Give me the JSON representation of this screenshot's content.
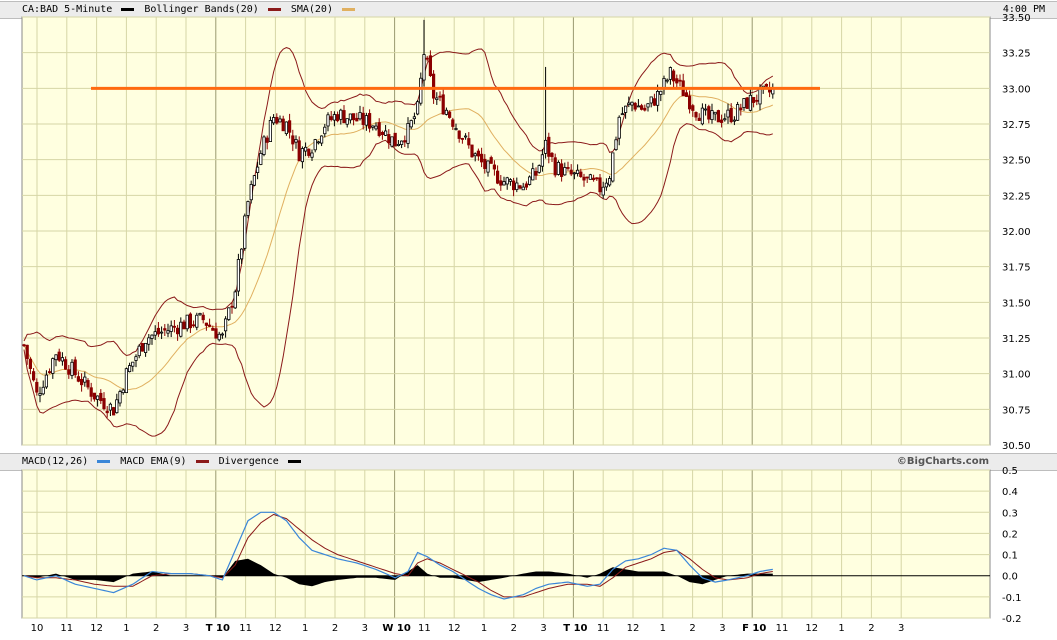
{
  "header": {
    "symbol": "CA:BAD 5-Minute",
    "legend": [
      {
        "label": "Bollinger Bands(20)",
        "color": "#000000"
      },
      {
        "label": "SMA(20)",
        "color": "#8b1a1a"
      },
      {
        "label": "",
        "color": "#e0b060"
      }
    ],
    "time": "4:00 PM"
  },
  "macd_header": {
    "legend": [
      {
        "label": "MACD(12,26)",
        "color": "#3a86d8"
      },
      {
        "label": "MACD EMA(9)",
        "color": "#8b1a1a"
      },
      {
        "label": "Divergence",
        "color": "#000000"
      }
    ],
    "watermark": "©BigCharts.com"
  },
  "colors": {
    "panel_bg": "#ffffe0",
    "grid": "#d6d6a6",
    "bollinger": "#8b1a1a",
    "sma": "#e0b060",
    "resistance": "#ff6a10",
    "candle_up": "#000000",
    "candle_down": "#8b0000",
    "macd": "#3a86d8",
    "macd_ema": "#8b1a1a",
    "divergence": "#000000"
  },
  "x_axis": {
    "labels": [
      "10",
      "11",
      "12",
      "1",
      "2",
      "3",
      "T 10",
      "11",
      "12",
      "1",
      "2",
      "3",
      "W 10",
      "11",
      "12",
      "1",
      "2",
      "3",
      "T 10",
      "11",
      "12",
      "1",
      "2",
      "3",
      "F 10",
      "11",
      "12",
      "1",
      "2",
      "3"
    ],
    "day_markers": [
      "T",
      "W",
      "T",
      "F"
    ]
  },
  "chart_data": [
    {
      "type": "candlestick",
      "title": "CA:BAD 5-Minute",
      "y_ticks": [
        "30.50",
        "30.75",
        "31.00",
        "31.25",
        "31.50",
        "31.75",
        "32.00",
        "32.25",
        "32.50",
        "32.75",
        "33.00",
        "33.25",
        "33.50"
      ],
      "ylim": [
        30.5,
        33.5
      ],
      "grid": true,
      "resistance_level": 33.0,
      "close_path": [
        [
          0,
          31.2
        ],
        [
          4,
          30.85
        ],
        [
          10,
          31.15
        ],
        [
          16,
          31.0
        ],
        [
          22,
          30.85
        ],
        [
          28,
          30.75
        ],
        [
          32,
          31.0
        ],
        [
          38,
          31.25
        ],
        [
          44,
          31.3
        ],
        [
          50,
          31.35
        ],
        [
          56,
          31.38
        ],
        [
          62,
          31.25
        ],
        [
          66,
          31.6
        ],
        [
          70,
          32.2
        ],
        [
          74,
          32.55
        ],
        [
          78,
          32.8
        ],
        [
          82,
          32.75
        ],
        [
          86,
          32.55
        ],
        [
          90,
          32.6
        ],
        [
          94,
          32.75
        ],
        [
          98,
          32.82
        ],
        [
          104,
          32.78
        ],
        [
          110,
          32.75
        ],
        [
          116,
          32.62
        ],
        [
          120,
          32.7
        ],
        [
          123,
          32.85
        ],
        [
          125,
          33.25
        ],
        [
          128,
          32.95
        ],
        [
          132,
          32.85
        ],
        [
          136,
          32.7
        ],
        [
          140,
          32.55
        ],
        [
          144,
          32.45
        ],
        [
          150,
          32.35
        ],
        [
          156,
          32.32
        ],
        [
          160,
          32.4
        ],
        [
          163,
          32.6
        ],
        [
          166,
          32.45
        ],
        [
          170,
          32.4
        ],
        [
          176,
          32.35
        ],
        [
          180,
          32.3
        ],
        [
          183,
          32.4
        ],
        [
          186,
          32.8
        ],
        [
          190,
          32.9
        ],
        [
          194,
          32.85
        ],
        [
          198,
          32.95
        ],
        [
          202,
          33.1
        ],
        [
          206,
          32.98
        ],
        [
          210,
          32.85
        ],
        [
          214,
          32.78
        ],
        [
          218,
          32.8
        ],
        [
          222,
          32.82
        ],
        [
          226,
          32.9
        ],
        [
          230,
          32.95
        ],
        [
          234,
          32.98
        ]
      ],
      "spikes": [
        {
          "bar": 125,
          "high": 33.48
        },
        {
          "bar": 163,
          "high": 33.15
        }
      ],
      "notes": "Bollinger Bands(20) and SMA(20) overlays on 5-minute bars over 4 sessions"
    },
    {
      "type": "line",
      "title": "MACD(12,26)",
      "y_ticks": [
        "0.5",
        "0.4",
        "0.3",
        "0.2",
        "0.1",
        "0.0",
        "-0.1",
        "-0.2"
      ],
      "ylim": [
        -0.2,
        0.5
      ],
      "grid": true,
      "series": [
        {
          "name": "MACD(12,26)",
          "points": [
            [
              0,
              0.0
            ],
            [
              4,
              -0.02
            ],
            [
              10,
              0.0
            ],
            [
              16,
              -0.04
            ],
            [
              22,
              -0.06
            ],
            [
              28,
              -0.08
            ],
            [
              34,
              -0.04
            ],
            [
              40,
              0.02
            ],
            [
              46,
              0.01
            ],
            [
              52,
              0.01
            ],
            [
              58,
              0.0
            ],
            [
              62,
              -0.02
            ],
            [
              66,
              0.12
            ],
            [
              70,
              0.26
            ],
            [
              74,
              0.3
            ],
            [
              78,
              0.3
            ],
            [
              82,
              0.26
            ],
            [
              86,
              0.18
            ],
            [
              90,
              0.12
            ],
            [
              94,
              0.1
            ],
            [
              98,
              0.08
            ],
            [
              104,
              0.06
            ],
            [
              110,
              0.03
            ],
            [
              116,
              -0.01
            ],
            [
              120,
              0.02
            ],
            [
              123,
              0.11
            ],
            [
              126,
              0.09
            ],
            [
              130,
              0.05
            ],
            [
              134,
              0.02
            ],
            [
              138,
              -0.02
            ],
            [
              142,
              -0.06
            ],
            [
              146,
              -0.09
            ],
            [
              150,
              -0.11
            ],
            [
              156,
              -0.09
            ],
            [
              160,
              -0.06
            ],
            [
              164,
              -0.04
            ],
            [
              170,
              -0.03
            ],
            [
              176,
              -0.05
            ],
            [
              180,
              -0.04
            ],
            [
              184,
              0.03
            ],
            [
              188,
              0.07
            ],
            [
              192,
              0.08
            ],
            [
              196,
              0.1
            ],
            [
              200,
              0.13
            ],
            [
              204,
              0.12
            ],
            [
              208,
              0.05
            ],
            [
              212,
              -0.01
            ],
            [
              216,
              -0.03
            ],
            [
              220,
              -0.02
            ],
            [
              226,
              0.0
            ],
            [
              230,
              0.02
            ],
            [
              234,
              0.03
            ]
          ]
        },
        {
          "name": "MACD EMA(9)",
          "points": [
            [
              0,
              0.0
            ],
            [
              4,
              -0.01
            ],
            [
              10,
              -0.01
            ],
            [
              16,
              -0.02
            ],
            [
              22,
              -0.04
            ],
            [
              28,
              -0.05
            ],
            [
              34,
              -0.05
            ],
            [
              40,
              0.0
            ],
            [
              46,
              0.01
            ],
            [
              52,
              0.01
            ],
            [
              58,
              0.0
            ],
            [
              62,
              -0.01
            ],
            [
              66,
              0.05
            ],
            [
              70,
              0.18
            ],
            [
              74,
              0.25
            ],
            [
              78,
              0.29
            ],
            [
              82,
              0.27
            ],
            [
              86,
              0.22
            ],
            [
              90,
              0.17
            ],
            [
              94,
              0.13
            ],
            [
              98,
              0.1
            ],
            [
              104,
              0.07
            ],
            [
              110,
              0.04
            ],
            [
              116,
              0.01
            ],
            [
              120,
              0.0
            ],
            [
              123,
              0.06
            ],
            [
              126,
              0.08
            ],
            [
              130,
              0.06
            ],
            [
              134,
              0.03
            ],
            [
              138,
              0.0
            ],
            [
              142,
              -0.03
            ],
            [
              146,
              -0.07
            ],
            [
              150,
              -0.1
            ],
            [
              156,
              -0.1
            ],
            [
              160,
              -0.08
            ],
            [
              164,
              -0.06
            ],
            [
              170,
              -0.04
            ],
            [
              176,
              -0.04
            ],
            [
              180,
              -0.05
            ],
            [
              184,
              -0.01
            ],
            [
              188,
              0.04
            ],
            [
              192,
              0.06
            ],
            [
              196,
              0.08
            ],
            [
              200,
              0.11
            ],
            [
              204,
              0.12
            ],
            [
              208,
              0.08
            ],
            [
              212,
              0.03
            ],
            [
              216,
              -0.01
            ],
            [
              220,
              -0.02
            ],
            [
              226,
              -0.01
            ],
            [
              230,
              0.01
            ],
            [
              234,
              0.02
            ]
          ]
        }
      ]
    }
  ]
}
